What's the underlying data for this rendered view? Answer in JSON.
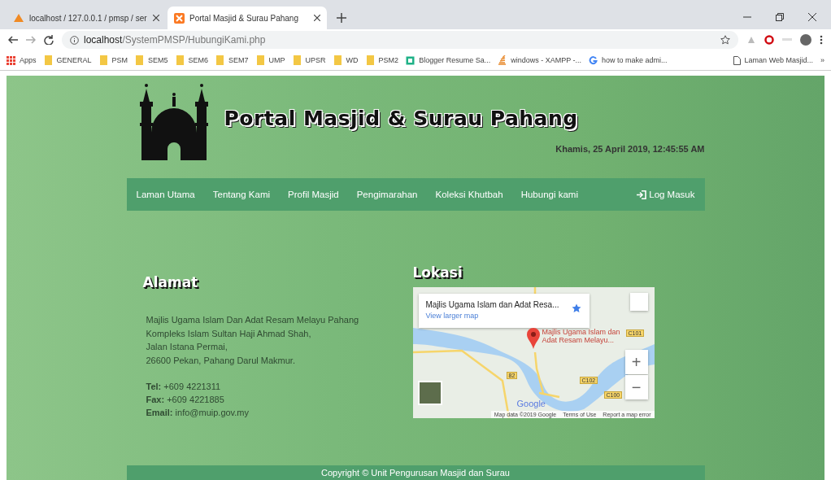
{
  "browser": {
    "tabs": [
      {
        "title": "localhost / 127.0.0.1 / pmsp / ser",
        "kind": "pma",
        "selected": false
      },
      {
        "title": "Portal Masjid & Surau Pahang",
        "kind": "xampp",
        "selected": true
      }
    ],
    "url": {
      "host": "localhost",
      "path": "/SystemPMSP/HubungiKami.php"
    },
    "bookmarks": [
      {
        "label": "Apps",
        "kind": "apps"
      },
      {
        "label": "GENERAL",
        "kind": "folder"
      },
      {
        "label": "PSM",
        "kind": "folder"
      },
      {
        "label": "SEM5",
        "kind": "folder"
      },
      {
        "label": "SEM6",
        "kind": "folder"
      },
      {
        "label": "SEM7",
        "kind": "folder"
      },
      {
        "label": "UMP",
        "kind": "folder"
      },
      {
        "label": "UPSR",
        "kind": "folder"
      },
      {
        "label": "WD",
        "kind": "folder"
      },
      {
        "label": "PSM2",
        "kind": "folder"
      },
      {
        "label": "Blogger Resume Sa...",
        "kind": "blogger"
      },
      {
        "label": "windows - XAMPP -...",
        "kind": "stack"
      },
      {
        "label": "how to make admi...",
        "kind": "google"
      },
      {
        "label": "Laman Web Masjid...",
        "kind": "page"
      }
    ],
    "more": "»"
  },
  "header": {
    "title": "Portal Masjid & Surau Pahang",
    "datetime": "Khamis, 25 April 2019, 12:45:55 AM"
  },
  "nav": {
    "items": [
      "Laman Utama",
      "Tentang Kami",
      "Profil Masjid",
      "Pengimarahan",
      "Koleksi Khutbah",
      "Hubungi kami"
    ],
    "login": "Log Masuk"
  },
  "address": {
    "heading": "Alamat",
    "lines": [
      "Majlis Ugama Islam Dan Adat Resam Melayu Pahang",
      "Kompleks Islam Sultan Haji Ahmad Shah,",
      "Jalan Istana Permai,",
      "26600 Pekan, Pahang Darul Makmur."
    ],
    "contacts": [
      {
        "label": "Tel:",
        "value": "+609 4221311"
      },
      {
        "label": "Fax:",
        "value": "+609 4221885"
      },
      {
        "label": "Email:",
        "value": "info@muip.gov.my"
      }
    ]
  },
  "location": {
    "heading": "Lokasi",
    "map": {
      "place": "Majlis Ugama Islam dan Adat Resa...",
      "link": "View larger map",
      "marker": "Majlis Ugama Islam dan Adat Resam Melayu...",
      "roads": [
        "C101",
        "82",
        "C102",
        "C100"
      ],
      "zoom_in": "+",
      "zoom_out": "−",
      "brand": "Google",
      "attribution": "Map data ©2019 Google",
      "terms": "Terms of Use",
      "report": "Report a map error"
    }
  },
  "footer": "Copyright © Unit Pengurusan Masjid dan Surau"
}
